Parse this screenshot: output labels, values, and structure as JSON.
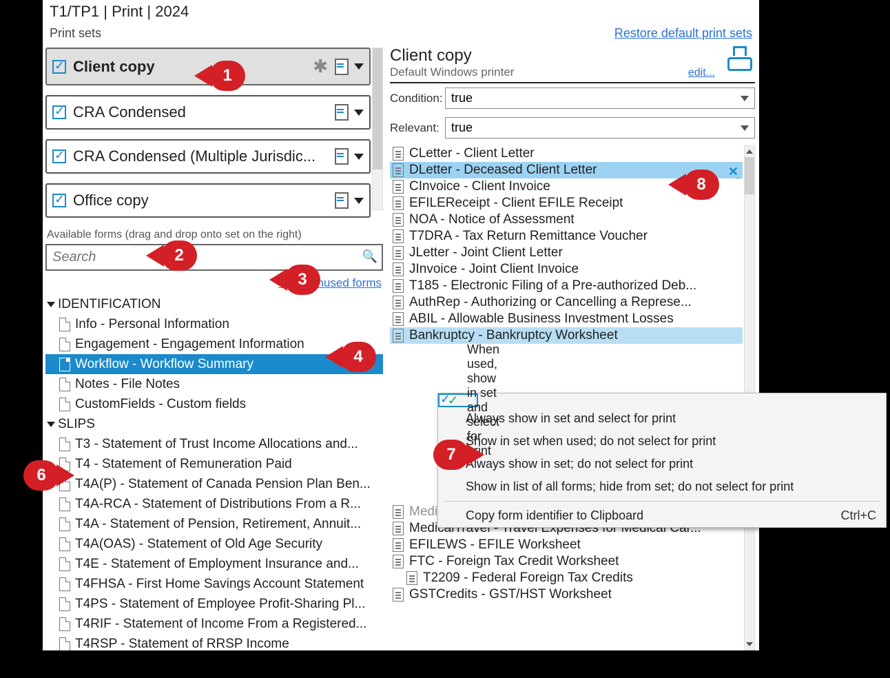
{
  "title": "T1/TP1 | Print | 2024",
  "header": {
    "left": "Print sets",
    "restore": "Restore default print sets"
  },
  "sets": [
    {
      "label": "Client copy",
      "selected": true,
      "showAsterisk": true
    },
    {
      "label": "CRA Condensed",
      "selected": false,
      "showAsterisk": false
    },
    {
      "label": "CRA Condensed (Multiple Jurisdic...",
      "selected": false,
      "showAsterisk": false
    },
    {
      "label": "Office copy",
      "selected": false,
      "showAsterisk": false
    }
  ],
  "available_label": "Available forms (drag and drop onto set on the right)",
  "search_placeholder": "Search",
  "show_unused": "Show unused forms",
  "tree": {
    "groups": [
      {
        "name": "IDENTIFICATION",
        "items": [
          "Info - Personal Information",
          "Engagement - Engagement Information",
          "Workflow - Workflow Summary",
          "Notes - File Notes",
          "CustomFields - Custom fields"
        ],
        "selected_index": 2
      },
      {
        "name": "SLIPS",
        "items": [
          "T3 - Statement of Trust Income Allocations and...",
          "T4 - Statement of Remuneration Paid",
          "T4A(P) - Statement of Canada Pension Plan Ben...",
          "T4A-RCA - Statement of Distributions From a R...",
          "T4A - Statement of Pension, Retirement, Annuit...",
          "T4A(OAS) - Statement of Old Age Security",
          "T4E - Statement of Employment Insurance and...",
          "T4FHSA - First Home Savings Account Statement",
          "T4PS - Statement of Employee Profit-Sharing Pl...",
          "T4RIF - Statement of Income From a Registered...",
          "T4RSP - Statement of RRSP Income"
        ]
      }
    ]
  },
  "right": {
    "title": "Client copy",
    "subtitle": "Default Windows printer",
    "edit": "edit...",
    "condition_label": "Condition:",
    "condition_value": "true",
    "relevant_label": "Relevant:",
    "relevant_value": "true",
    "forms": [
      {
        "label": "CLetter - Client Letter"
      },
      {
        "label": "DLetter - Deceased Client Letter",
        "sel": true,
        "x": true
      },
      {
        "label": "CInvoice - Client Invoice"
      },
      {
        "label": "EFILEReceipt - Client EFILE Receipt"
      },
      {
        "label": "NOA - Notice of Assessment"
      },
      {
        "label": "T7DRA - Tax Return Remittance Voucher"
      },
      {
        "label": "JLetter - Joint Client Letter"
      },
      {
        "label": "JInvoice - Joint Client Invoice"
      },
      {
        "label": "T185 - Electronic Filing of a Pre-authorized Deb..."
      },
      {
        "label": "AuthRep - Authorizing or Cancelling a Represe..."
      },
      {
        "label": "ABIL - Allowable Business Investment Losses"
      },
      {
        "label": "Bankruptcy - Bankruptcy Worksheet",
        "sel2": true
      },
      {
        "label": "",
        "hidden": true
      },
      {
        "label": "",
        "hidden": true
      },
      {
        "label": "",
        "hidden": true
      },
      {
        "label": "",
        "hidden": true
      },
      {
        "label": "",
        "hidden": true
      },
      {
        "label": "",
        "hidden": true
      },
      {
        "label": "",
        "hidden": true
      },
      {
        "label": "",
        "hidden": true
      },
      {
        "label": "Medical - Medical Expenses Worksheet",
        "cut": true
      },
      {
        "label": "MedicalTravel - Travel Expenses for Medical Car..."
      },
      {
        "label": "EFILEWS - EFILE Worksheet"
      },
      {
        "label": "FTC - Foreign Tax Credit Worksheet"
      },
      {
        "label": "T2209 - Federal Foreign Tax Credits",
        "indent": true
      },
      {
        "label": "GSTCredits - GST/HST Worksheet"
      }
    ]
  },
  "context_menu": {
    "items": [
      {
        "label": "When used, show in set and select for print",
        "checked": true
      },
      {
        "label": "Always show in set and select for print"
      },
      {
        "label": "Show in set when used; do not select for print"
      },
      {
        "label": "Always show in set; do not select for print"
      },
      {
        "label": "Show in list of all forms; hide from set; do not select for print"
      }
    ],
    "copy_label": "Copy form identifier to Clipboard",
    "copy_shortcut": "Ctrl+C"
  },
  "callouts": {
    "1": "1",
    "2": "2",
    "3": "3",
    "4": "4",
    "6": "6",
    "7": "7",
    "8": "8"
  }
}
